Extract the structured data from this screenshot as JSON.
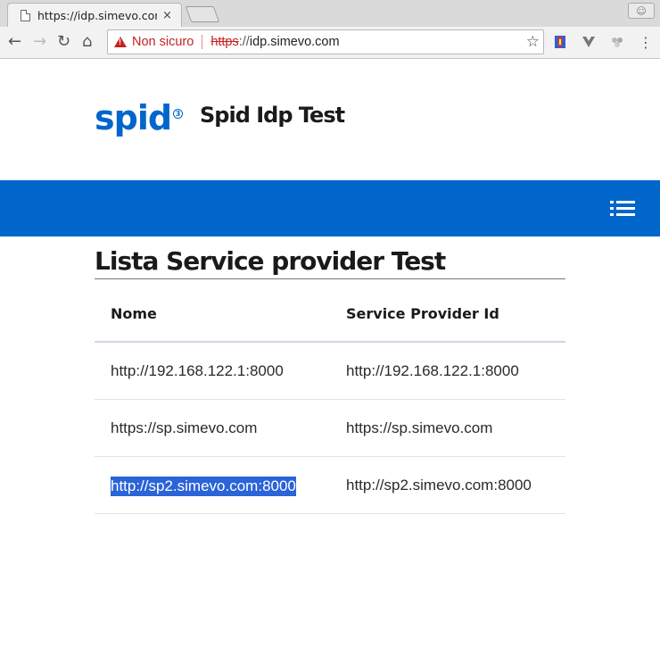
{
  "browser": {
    "tab_title": "https://idp.simevo.com",
    "close_glyph": "×",
    "omnibox": {
      "security_label": "Non sicuro",
      "scheme": "https",
      "separator": "://",
      "host": "idp.simevo.com"
    },
    "icons": [
      "back-icon",
      "forward-icon",
      "reload-icon",
      "home-icon",
      "warning-icon",
      "star-icon",
      "extension-icon",
      "menu-kebab-icon",
      "profile-icon"
    ]
  },
  "header": {
    "logo_text": "spid",
    "logo_sup": "3",
    "site_title": "Spid Idp Test"
  },
  "colors": {
    "brand_blue": "#0066cc",
    "selection": "#2b63d8",
    "insecure_red": "#c5221f"
  },
  "main": {
    "heading": "Lista Service provider Test",
    "table": {
      "columns": [
        "Nome",
        "Service Provider Id"
      ],
      "rows": [
        [
          "http://192.168.122.1:8000",
          "http://192.168.122.1:8000"
        ],
        [
          "https://sp.simevo.com",
          "https://sp.simevo.com"
        ],
        [
          "http://sp2.simevo.com:8000",
          "http://sp2.simevo.com:8000"
        ]
      ]
    }
  }
}
